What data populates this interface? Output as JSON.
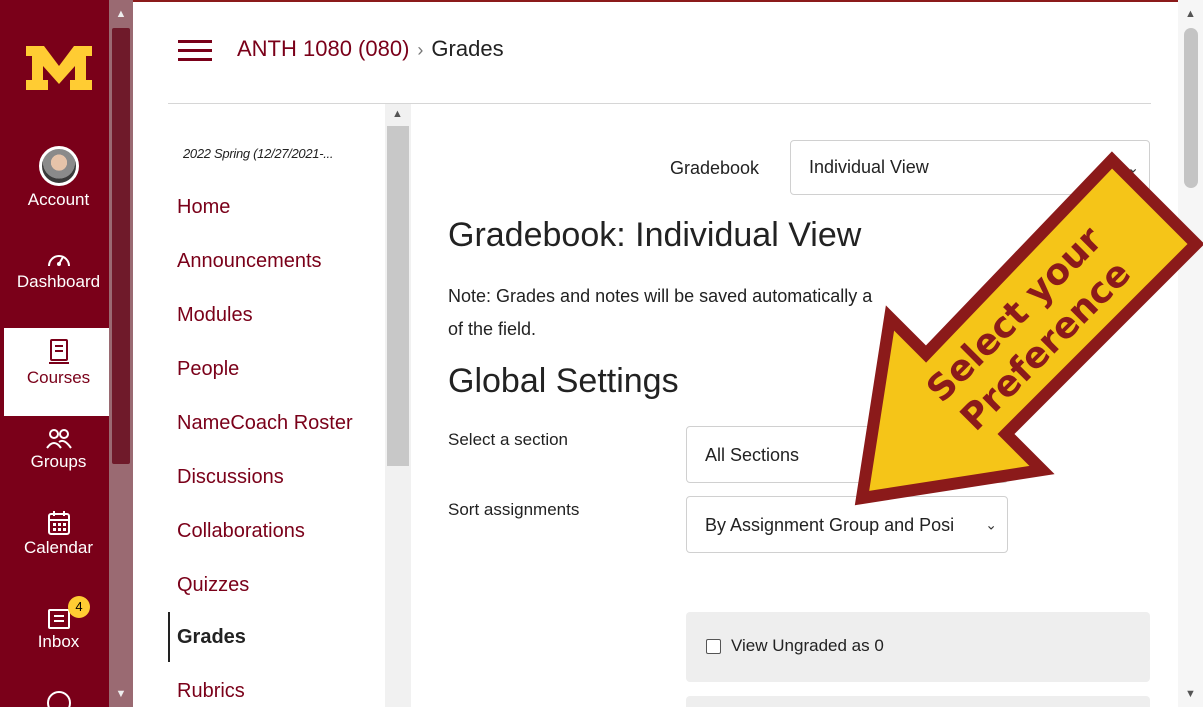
{
  "global_nav": {
    "logo": "M",
    "items": [
      {
        "label": "Account",
        "icon": "avatar"
      },
      {
        "label": "Dashboard",
        "icon": "dashboard-icon"
      },
      {
        "label": "Courses",
        "icon": "courses-icon"
      },
      {
        "label": "Groups",
        "icon": "groups-icon"
      },
      {
        "label": "Calendar",
        "icon": "calendar-icon"
      },
      {
        "label": "Inbox",
        "icon": "inbox-icon",
        "badge": "4"
      }
    ]
  },
  "header": {
    "course_link": "ANTH 1080 (080)",
    "separator": "›",
    "current": "Grades"
  },
  "course_nav": {
    "term": "2022 Spring (12/27/2021-...",
    "items": [
      {
        "label": "Home"
      },
      {
        "label": "Announcements"
      },
      {
        "label": "Modules"
      },
      {
        "label": "People"
      },
      {
        "label": "NameCoach Roster"
      },
      {
        "label": "Discussions"
      },
      {
        "label": "Collaborations"
      },
      {
        "label": "Quizzes"
      },
      {
        "label": "Grades"
      },
      {
        "label": "Rubrics"
      }
    ]
  },
  "content": {
    "gradebook_label": "Gradebook",
    "gradebook_select": "Individual View",
    "title": "Gradebook: Individual View",
    "note_line1": "Note: Grades and notes will be saved automatically a",
    "note_line2": "of the field.",
    "global_settings": "Global Settings",
    "section_label": "Select a section",
    "section_value": "All Sections",
    "sort_label": "Sort assignments",
    "sort_value": "By Assignment Group and Posi",
    "checkbox_label": "View Ungraded as 0"
  },
  "callout": {
    "line1": "Select your",
    "line2": "Preference",
    "fill": "#f5c518",
    "border": "#8b1a1a"
  },
  "colors": {
    "brand": "#7a0019",
    "gold": "#ffcc33"
  }
}
